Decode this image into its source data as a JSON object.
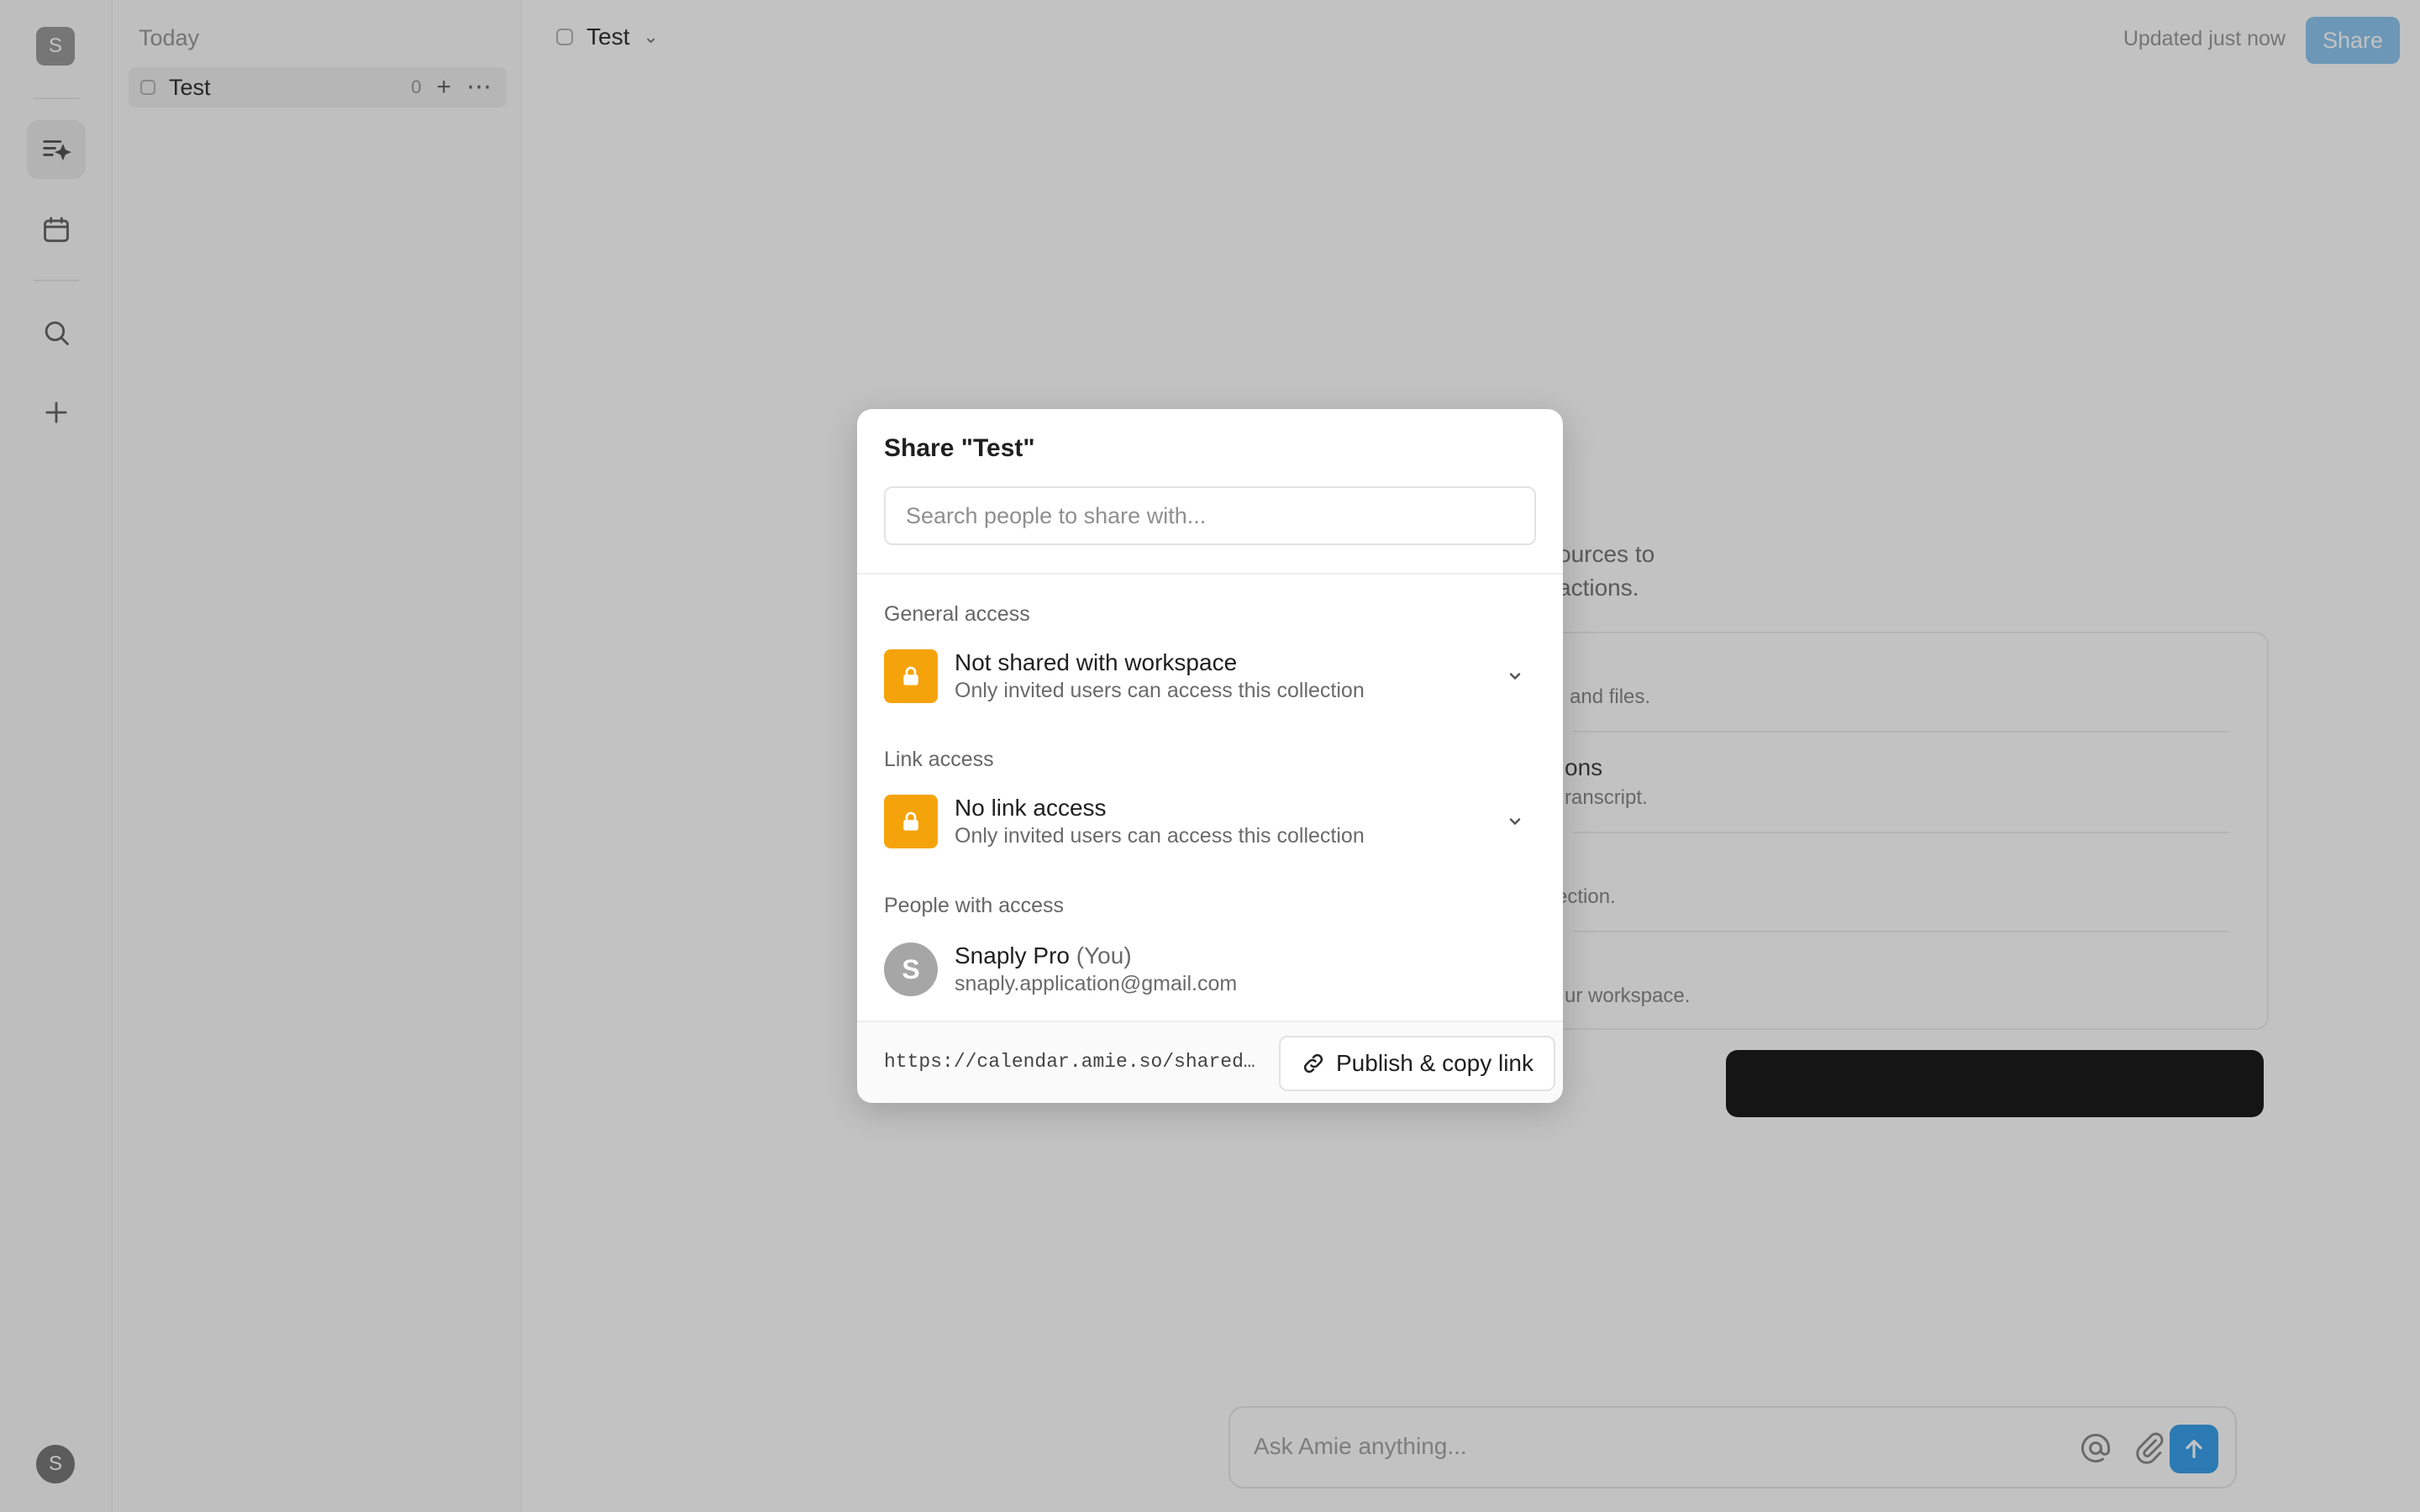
{
  "rail": {
    "workspace_initial": "S",
    "user_initial": "S",
    "icons": [
      "notes-sparkle-icon",
      "calendar-icon",
      "search-icon",
      "plus-icon"
    ]
  },
  "list": {
    "heading": "Today",
    "items": [
      {
        "label": "Test",
        "count": "0"
      }
    ]
  },
  "topbar": {
    "title": "Test",
    "updated": "Updated just now",
    "share_label": "Share",
    "share_color": "#8ec7f0"
  },
  "background": {
    "fragments": [
      "ources to",
      "actions.",
      "and files.",
      "ons",
      "ranscript.",
      "ection.",
      "ur workspace."
    ]
  },
  "ask": {
    "placeholder": "Ask Amie anything..."
  },
  "modal": {
    "title": "Share \"Test\"",
    "search_placeholder": "Search people to share with...",
    "general_access": {
      "label": "General access",
      "title": "Not shared with workspace",
      "subtitle": "Only invited users can access this collection"
    },
    "link_access": {
      "label": "Link access",
      "title": "No link access",
      "subtitle": "Only invited users can access this collection"
    },
    "people": {
      "label": "People with access",
      "items": [
        {
          "initial": "S",
          "name": "Snaply Pro",
          "you": "(You)",
          "email": "snaply.application@gmail.com"
        }
      ]
    },
    "footer": {
      "url": "https://calendar.amie.so/shared/…",
      "publish_label": "Publish & copy link"
    },
    "accent_color": "#f5a30a"
  }
}
